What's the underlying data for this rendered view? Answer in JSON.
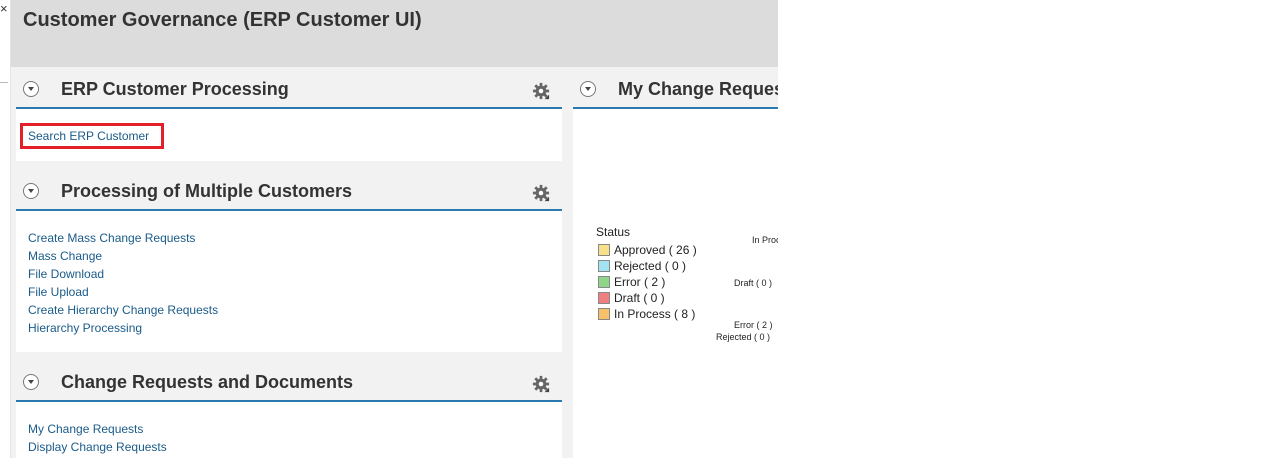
{
  "page": {
    "title": "Customer Governance (ERP Customer UI)"
  },
  "left_strip": {
    "close_glyph": "×"
  },
  "panels": {
    "erp": {
      "title": "ERP Customer Processing",
      "links": [
        "Search ERP Customer"
      ]
    },
    "multiple": {
      "title": "Processing of Multiple Customers",
      "links": [
        "Create Mass Change Requests",
        "Mass Change",
        "File Download",
        "File Upload",
        "Create Hierarchy Change Requests",
        "Hierarchy Processing"
      ]
    },
    "crdocs": {
      "title": "Change Requests and Documents",
      "links": [
        "My Change Requests",
        "Display Change Requests"
      ]
    },
    "mycr": {
      "title": "My Change Requests",
      "chart_labels": {
        "in_process": "In Proc",
        "draft": "Draft ( 0 )",
        "error": "Error ( 2 )",
        "rejected": "Rejected ( 0 )"
      },
      "legend": {
        "title": "Status",
        "items": [
          {
            "label": "Approved ( 26 )",
            "color": "#f6e08c"
          },
          {
            "label": "Rejected ( 0 )",
            "color": "#a3e3f2"
          },
          {
            "label": "Error ( 2 )",
            "color": "#8fd68a"
          },
          {
            "label": "Draft ( 0 )",
            "color": "#f08080"
          },
          {
            "label": "In Process ( 8 )",
            "color": "#f7c06a"
          }
        ]
      }
    }
  },
  "colors": {
    "accent": "#2a7ab0",
    "link": "#1a5b8a",
    "highlight": "#e2202a",
    "header_bg": "#dcdcdc"
  },
  "icons": {
    "toggle": "chevron-down-icon",
    "settings": "gear-icon"
  }
}
